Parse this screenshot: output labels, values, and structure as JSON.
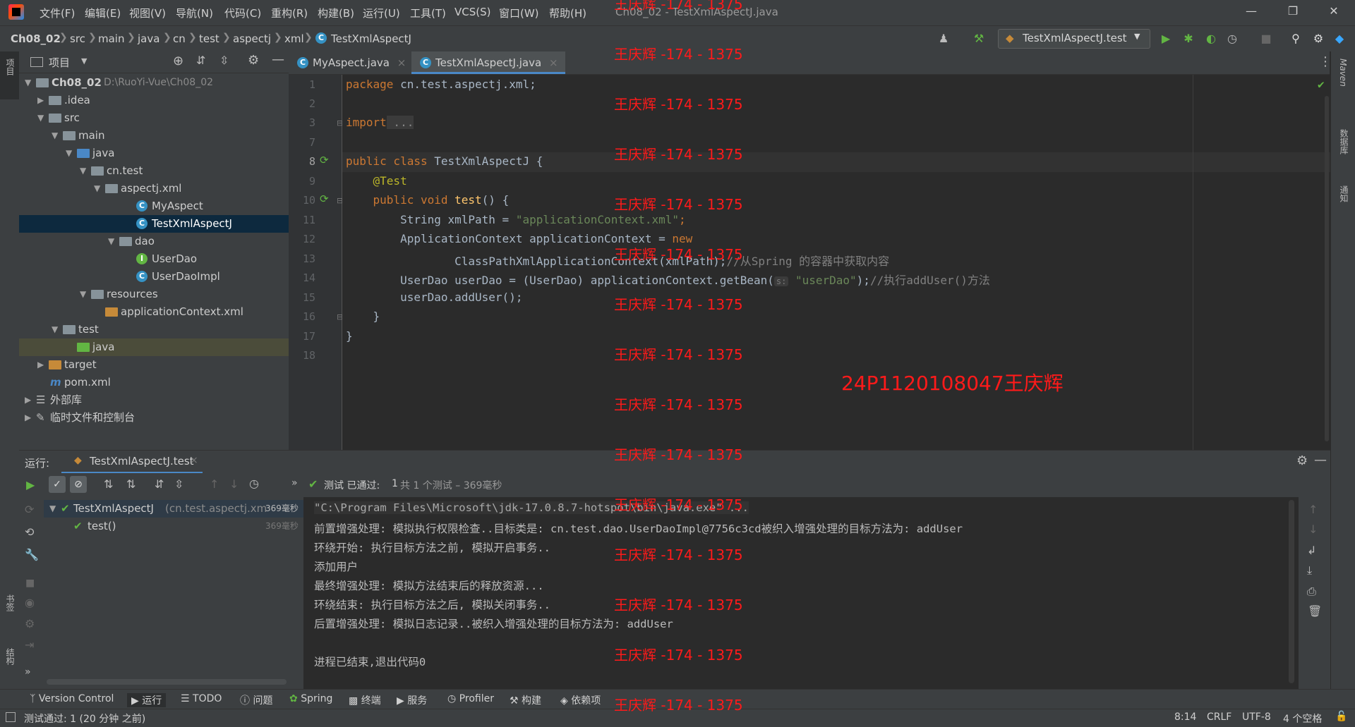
{
  "title_bar": {
    "menu": [
      "文件(F)",
      "编辑(E)",
      "视图(V)",
      "导航(N)",
      "代码(C)",
      "重构(R)",
      "构建(B)",
      "运行(U)",
      "工具(T)",
      "VCS(S)",
      "窗口(W)",
      "帮助(H)"
    ],
    "window_title": "Ch08_02 - TestXmlAspectJ.java"
  },
  "breadcrumbs": [
    "Ch08_02",
    "src",
    "main",
    "java",
    "cn",
    "test",
    "aspectj",
    "xml",
    "TestXmlAspectJ"
  ],
  "run_config": "TestXmlAspectJ.test",
  "left_strip_labels": {
    "project": "项目",
    "bookmarks": "书签",
    "structure": "结构"
  },
  "right_strip_labels": {
    "maven": "Maven",
    "database": "数据库",
    "notifications": "通知"
  },
  "project_panel": {
    "title": "项目",
    "tree": [
      {
        "label": "Ch08_02",
        "path": "D:\\RuoYi-Vue\\Ch08_02"
      },
      {
        "label": ".idea"
      },
      {
        "label": "src"
      },
      {
        "label": "main"
      },
      {
        "label": "java"
      },
      {
        "label": "cn.test"
      },
      {
        "label": "aspectj.xml"
      },
      {
        "label": "MyAspect"
      },
      {
        "label": "TestXmlAspectJ"
      },
      {
        "label": "dao"
      },
      {
        "label": "UserDao"
      },
      {
        "label": "UserDaoImpl"
      },
      {
        "label": "resources"
      },
      {
        "label": "applicationContext.xml"
      },
      {
        "label": "test"
      },
      {
        "label": "java"
      },
      {
        "label": "target"
      },
      {
        "label": "pom.xml"
      },
      {
        "label": "外部库"
      },
      {
        "label": "临时文件和控制台"
      }
    ]
  },
  "editor": {
    "tabs": [
      "MyAspect.java",
      "TestXmlAspectJ.java"
    ],
    "line_numbers": [
      "1",
      "2",
      "3",
      "7",
      "8",
      "9",
      "10",
      "11",
      "12",
      "13",
      "14",
      "15",
      "16",
      "17",
      "18"
    ],
    "code": {
      "l1_kw": "package",
      "l1_rest": " cn.test.aspectj.xml;",
      "l3_kw": "import",
      "l3_rest": " ...",
      "l8_kw": "public class",
      "l8_rest": " TestXmlAspectJ {",
      "l9": "    @Test",
      "l10_kw": "    public void",
      "l10_fn": " test",
      "l10_rest": "() {",
      "l11_a": "        String xmlPath = ",
      "l11_str": "\"applicationContext.xml\"",
      "l11_b": ";",
      "l12_a": "        ApplicationContext applicationContext = ",
      "l12_kw": "new",
      "l13_a": "                ClassPathXmlApplicationContext(xmlPath);",
      "l13_cm": "//从Spring 的容器中获取内容",
      "l14_a": "        UserDao userDao = (UserDao) applicationContext.getBean(",
      "l14_hint": "s:",
      "l14_str": "\"userDao\"",
      "l14_b": ");",
      "l14_cm": "//执行addUser()方法",
      "l15": "        userDao.addUser();",
      "l16": "    }",
      "l17": "}"
    }
  },
  "run_panel": {
    "label": "运行:",
    "tab": "TestXmlAspectJ.test",
    "status_prefix": "测试 已通过:",
    "status_count": "1",
    "status_detail": "共 1 个测试 – 369毫秒",
    "tree": [
      {
        "label": "TestXmlAspectJ",
        "detail": "(cn.test.aspectj.xm",
        "time": "369毫秒"
      },
      {
        "label": "test()",
        "time": "369毫秒"
      }
    ],
    "console": [
      "\"C:\\Program Files\\Microsoft\\jdk-17.0.8.7-hotspot\\bin\\java.exe\" ...",
      "前置增强处理: 模拟执行权限检查..目标类是: cn.test.dao.UserDaoImpl@7756c3cd被织入增强处理的目标方法为: addUser",
      "环绕开始: 执行目标方法之前, 模拟开启事务..",
      "添加用户",
      "最终增强处理: 模拟方法结束后的释放资源...",
      "环绕结束: 执行目标方法之后, 模拟关闭事务..",
      "后置增强处理: 模拟日志记录..被织入增强处理的目标方法为: addUser",
      "",
      "进程已结束,退出代码0"
    ]
  },
  "bottom_tools": [
    "Version Control",
    "运行",
    "TODO",
    "问题",
    "Spring",
    "终端",
    "服务",
    "Profiler",
    "构建",
    "依赖项"
  ],
  "status_bar": {
    "message": "测试通过: 1 (20 分钟 之前)",
    "position": "8:14",
    "line_sep": "CRLF",
    "encoding": "UTF-8",
    "indent": "4 个空格"
  },
  "watermark": {
    "repeated": "王庆辉 -174 - 1375",
    "student": "24P1120108047王庆辉"
  },
  "colors": {
    "bg_editor": "#2b2b2b",
    "bg_panel": "#3c3f41",
    "selection": "#0d293e",
    "keyword": "#cc7832",
    "string": "#6a8759",
    "annotation": "#bbb529",
    "function": "#ffc66d",
    "comment": "#808080",
    "watermark": "#ff1a1a",
    "pass_green": "#62b543"
  }
}
